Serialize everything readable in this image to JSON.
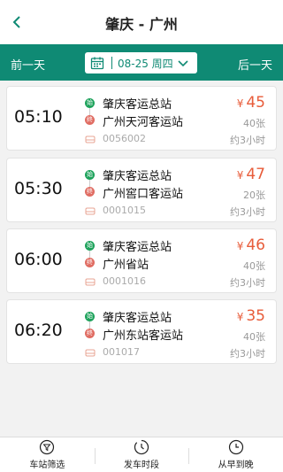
{
  "header": {
    "title": "肇庆 - 广州",
    "back_icon": "chevron-left-icon"
  },
  "datebar": {
    "prev": "前一天",
    "next": "后一天",
    "date": "08-25 周四",
    "calendar_icon": "calendar-icon",
    "dropdown_icon": "chevron-down-icon"
  },
  "trips": [
    {
      "time": "05:10",
      "from": "肇庆客运总站",
      "to": "广州天河客运站",
      "train_no": "0056002",
      "price": "45",
      "seats": "40张",
      "duration": "约3小时"
    },
    {
      "time": "05:30",
      "from": "肇庆客运总站",
      "to": "广州窖口客运站",
      "train_no": "0001015",
      "price": "47",
      "seats": "20张",
      "duration": "约3小时"
    },
    {
      "time": "06:00",
      "from": "肇庆客运总站",
      "to": "广州省站",
      "train_no": "0001016",
      "price": "46",
      "seats": "40张",
      "duration": "约3小时"
    },
    {
      "time": "06:20",
      "from": "肇庆客运总站",
      "to": "广州东站客运站",
      "train_no": "001017",
      "price": "35",
      "seats": "40张",
      "duration": "约3小时"
    }
  ],
  "labels": {
    "start_mark": "始",
    "end_mark": "终",
    "currency": "¥"
  },
  "tabbar": [
    {
      "label": "车站筛选",
      "icon": "filter-icon"
    },
    {
      "label": "发车时段",
      "icon": "clock-icon"
    },
    {
      "label": "从早到晚",
      "icon": "clock-icon"
    }
  ],
  "colors": {
    "primary": "#0f8a74",
    "price": "#e85c3a",
    "start": "#1da25b",
    "end": "#e06c62"
  }
}
